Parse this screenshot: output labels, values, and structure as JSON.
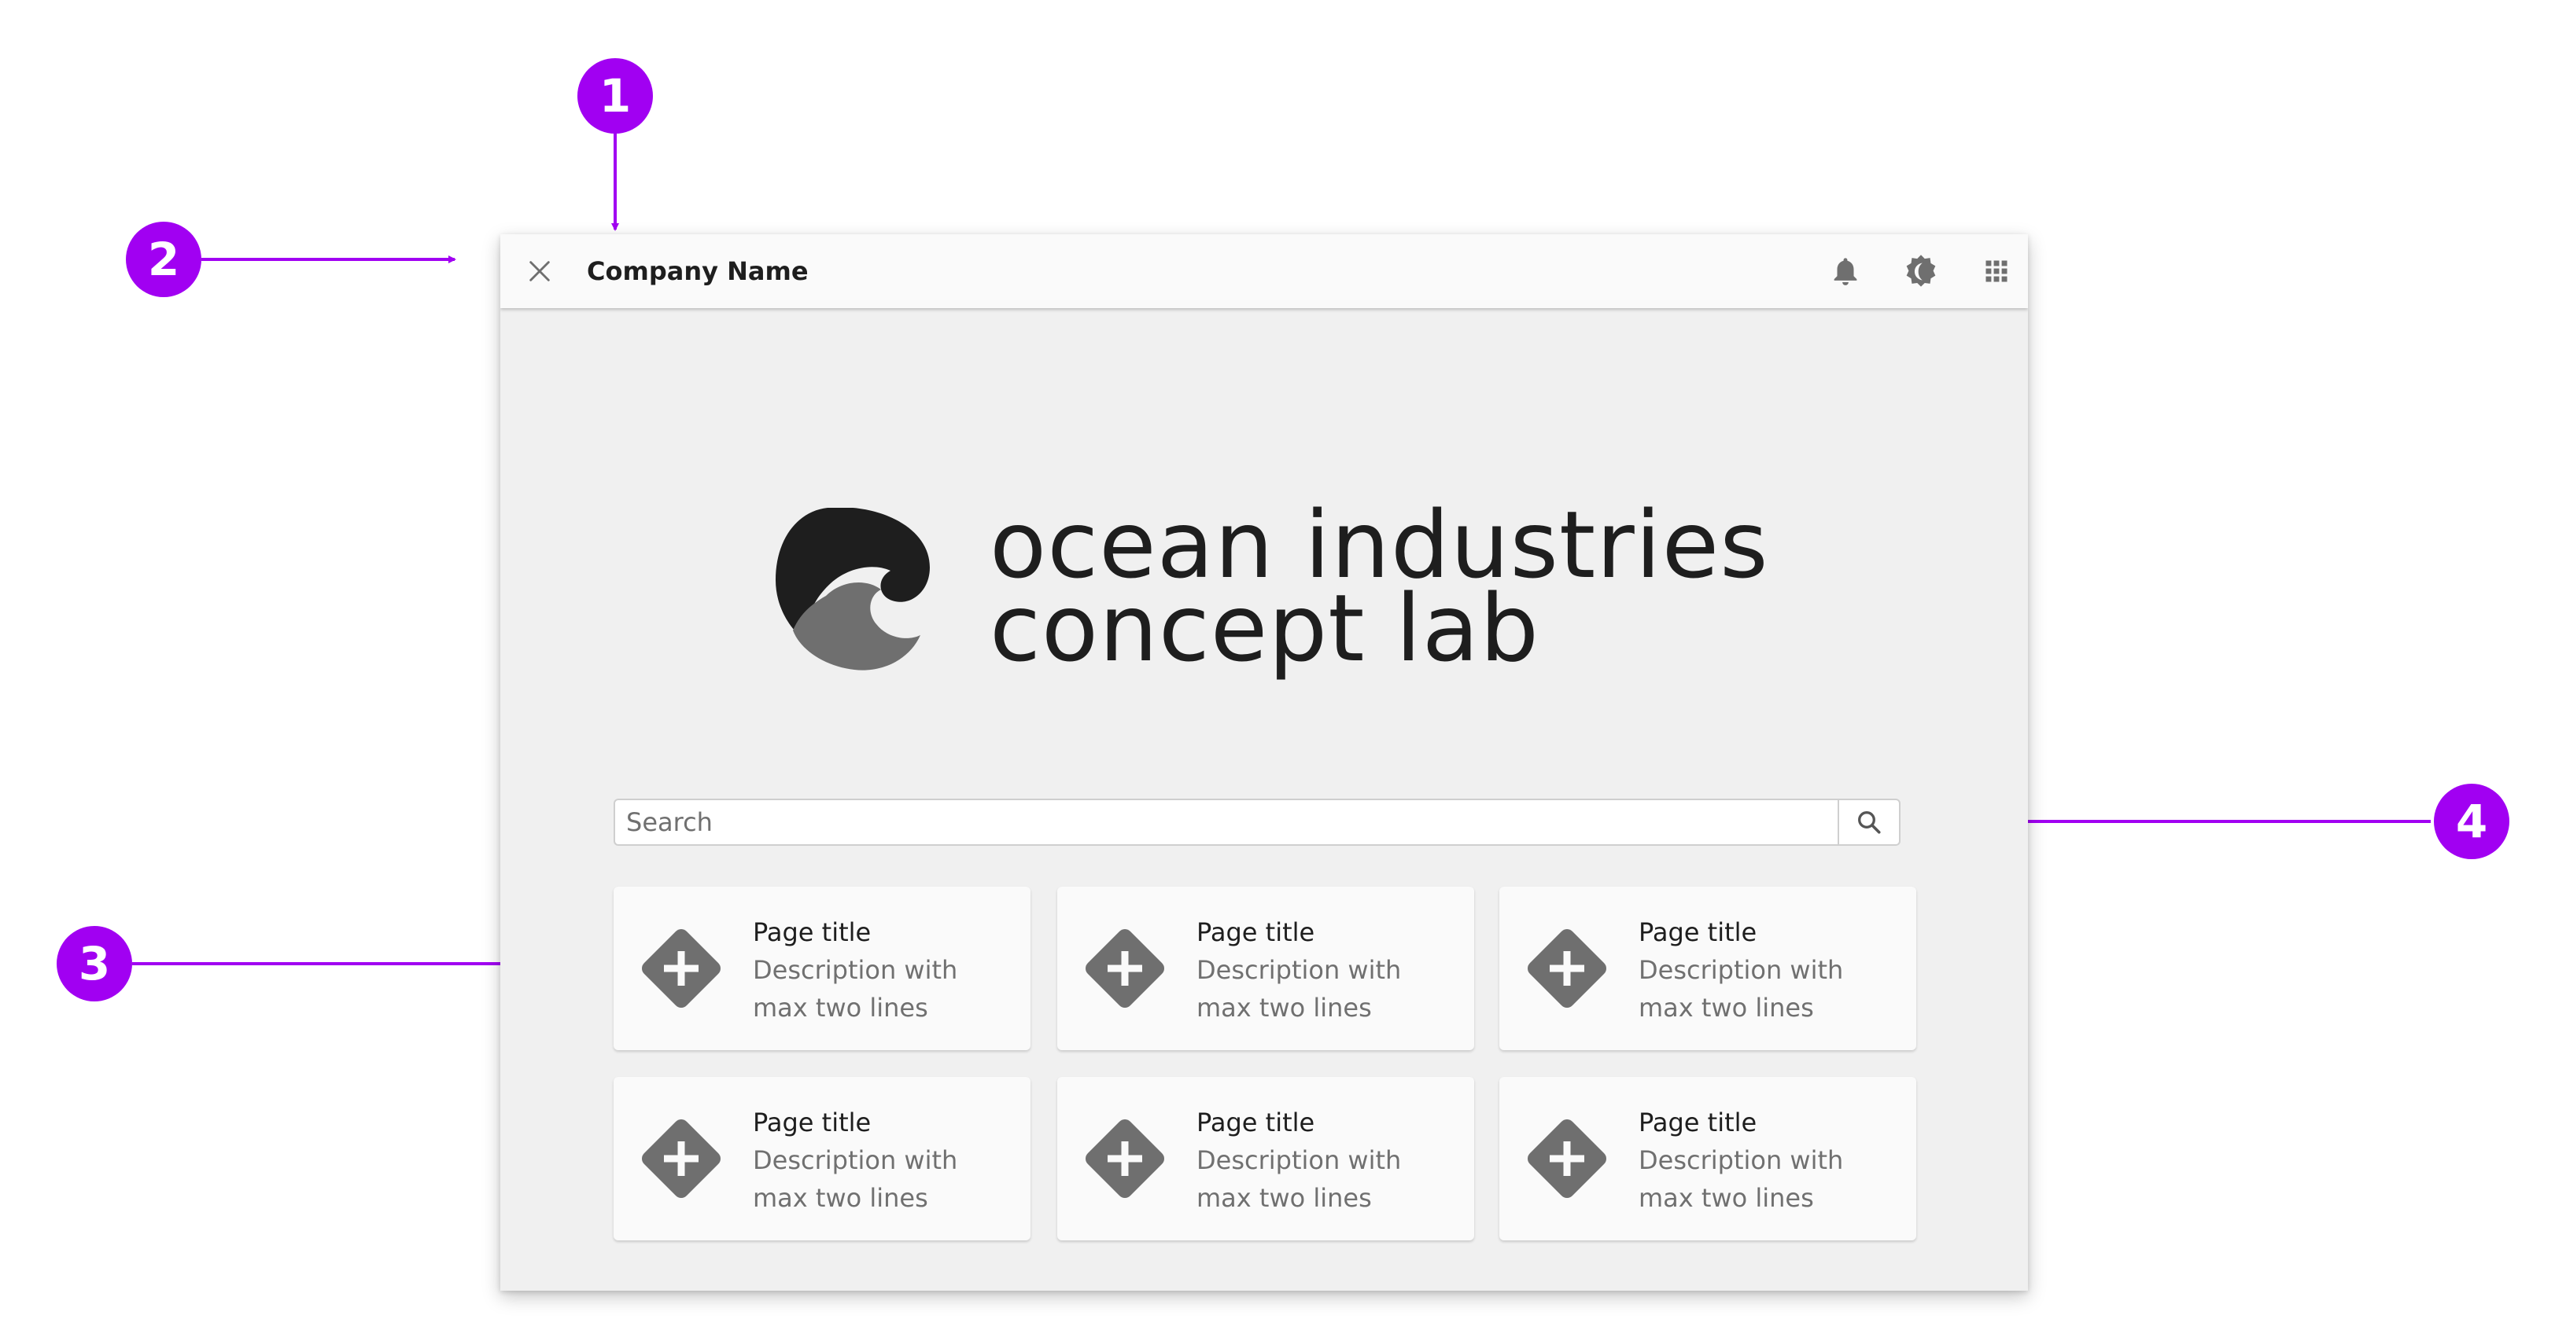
{
  "annotations": [
    {
      "number": "1"
    },
    {
      "number": "2"
    },
    {
      "number": "3"
    },
    {
      "number": "4"
    }
  ],
  "colors": {
    "annotation": "#a100f2",
    "icon": "#6f6f6f",
    "logo_dark": "#1e1e1e",
    "logo_mid": "#6f6f6f"
  },
  "topbar": {
    "company_name": "Company Name",
    "icons": [
      "close-icon",
      "bell-icon",
      "theme-toggle-icon",
      "apps-grid-icon"
    ]
  },
  "logo": {
    "line1": "ocean industries",
    "line2": "concept lab"
  },
  "search": {
    "placeholder": "Search"
  },
  "cards": [
    {
      "title": "Page title",
      "description": "Description with max two lines"
    },
    {
      "title": "Page title",
      "description": "Description with max two lines"
    },
    {
      "title": "Page title",
      "description": "Description with max two lines"
    },
    {
      "title": "Page title",
      "description": "Description with max two lines"
    },
    {
      "title": "Page title",
      "description": "Description with max two lines"
    },
    {
      "title": "Page title",
      "description": "Description with max two lines"
    }
  ]
}
